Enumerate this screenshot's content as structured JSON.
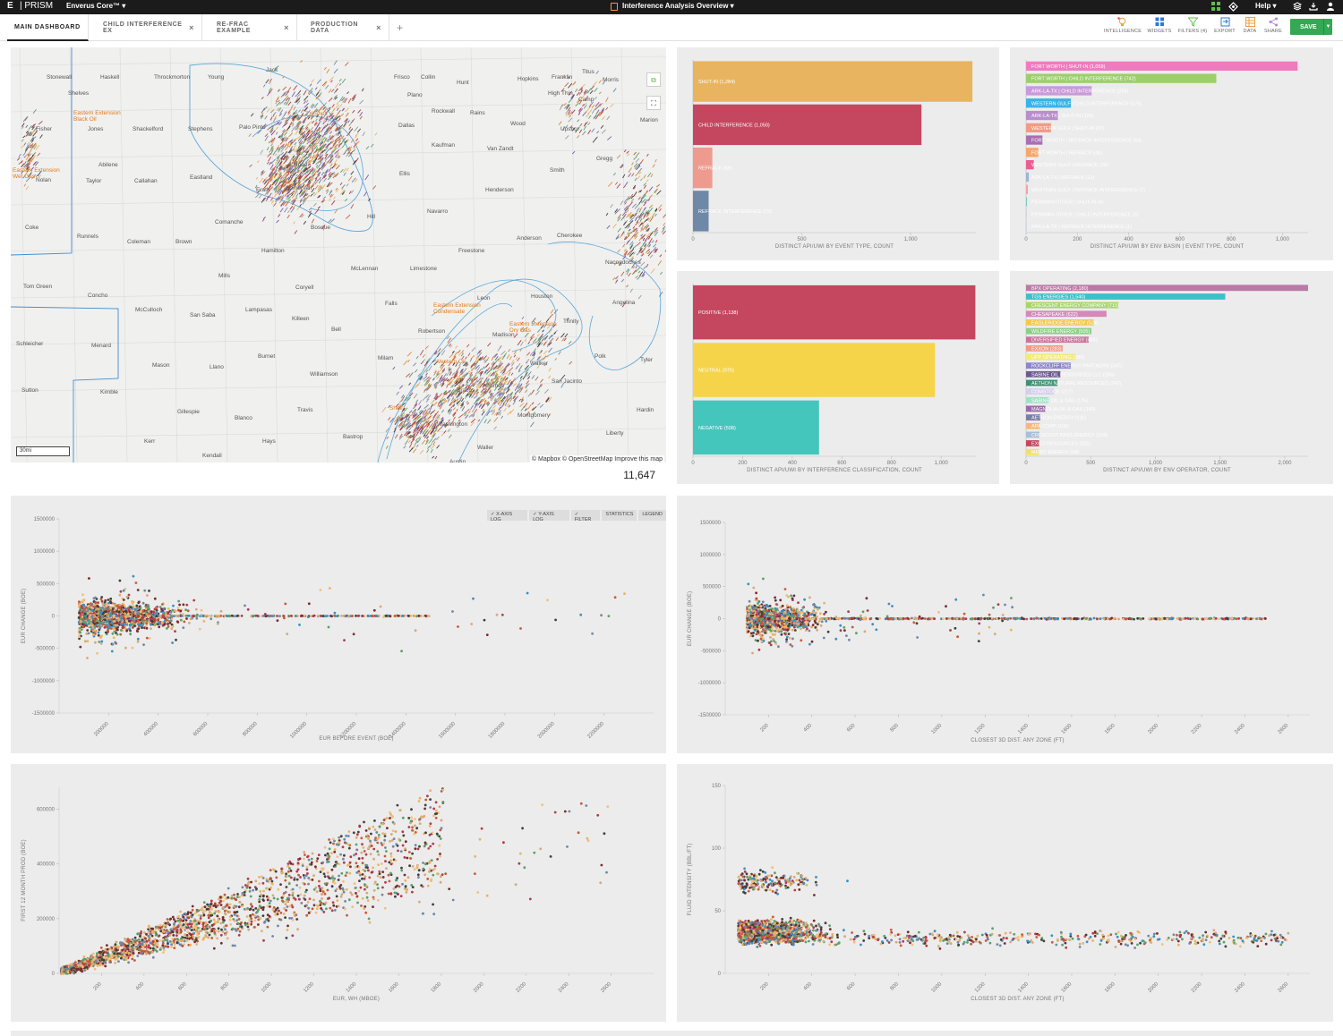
{
  "topbar": {
    "logo": "E",
    "brand": "| PRISM",
    "product": "Enverus Core™ ▾",
    "title": "Interference Analysis Overview ▾",
    "help": "Help ▾"
  },
  "tabs": [
    {
      "label": "MAIN DASHBOARD",
      "active": true
    },
    {
      "label": "CHILD INTERFERENCE EX",
      "active": false
    },
    {
      "label": "RE-FRAC EXAMPLE",
      "active": false
    },
    {
      "label": "PRODUCTION DATA",
      "active": false
    }
  ],
  "tab_add": "+",
  "tab_close": "×",
  "tools": [
    {
      "label": "INTELLIGENCE",
      "icon": "lightbulb-icon"
    },
    {
      "label": "WIDGETS",
      "icon": "grid-icon"
    },
    {
      "label": "FILTERS (4)",
      "icon": "filter-icon"
    },
    {
      "label": "EXPORT",
      "icon": "export-icon"
    },
    {
      "label": "DATA",
      "icon": "table-icon"
    },
    {
      "label": "SHARE",
      "icon": "share-icon"
    }
  ],
  "save_label": "SAVE",
  "map": {
    "count": "11,647",
    "attribution": "© Mapbox © OpenStreetMap  Improve this map",
    "scale": "30mi",
    "labels": [
      {
        "t": "Stonewall"
      },
      {
        "t": "Haskell"
      },
      {
        "t": "Throckmorton"
      },
      {
        "t": "Young"
      },
      {
        "t": "Jack"
      },
      {
        "t": "Shelves"
      },
      {
        "t": "Collin"
      },
      {
        "t": "Hunt"
      },
      {
        "t": "Hopkins"
      },
      {
        "t": "Franklin"
      },
      {
        "t": "Titus"
      },
      {
        "t": "Fisher"
      },
      {
        "t": "Jones"
      },
      {
        "t": "Shackelford"
      },
      {
        "t": "Stephens"
      },
      {
        "t": "Palo Pinto"
      },
      {
        "t": "Dallas"
      },
      {
        "t": "Rockwall"
      },
      {
        "t": "Rains"
      },
      {
        "t": "Wood"
      },
      {
        "t": "Upshur"
      },
      {
        "t": "Abilene"
      },
      {
        "t": "Taylor"
      },
      {
        "t": "Callahan"
      },
      {
        "t": "Eastland"
      },
      {
        "t": "Erath"
      },
      {
        "t": "Kaufman"
      },
      {
        "t": "Van Zandt"
      },
      {
        "t": "Smith"
      },
      {
        "t": "Ellis"
      },
      {
        "t": "Henderson"
      },
      {
        "t": "Nolan"
      },
      {
        "t": "Coke"
      },
      {
        "t": "Runnels"
      },
      {
        "t": "Coleman"
      },
      {
        "t": "Brown"
      },
      {
        "t": "Comanche"
      },
      {
        "t": "Hamilton"
      },
      {
        "t": "Bosque"
      },
      {
        "t": "Hill"
      },
      {
        "t": "Navarro"
      },
      {
        "t": "Anderson"
      },
      {
        "t": "Cherokee"
      },
      {
        "t": "Mills"
      },
      {
        "t": "McLennan"
      },
      {
        "t": "Limestone"
      },
      {
        "t": "Freestone"
      },
      {
        "t": "Nacogdoches"
      },
      {
        "t": "Tom Green"
      },
      {
        "t": "Concho"
      },
      {
        "t": "McCulloch"
      },
      {
        "t": "San Saba"
      },
      {
        "t": "Lampasas"
      },
      {
        "t": "Coryell"
      },
      {
        "t": "Falls"
      },
      {
        "t": "Leon"
      },
      {
        "t": "Houston"
      },
      {
        "t": "Angelina"
      },
      {
        "t": "Trinity"
      },
      {
        "t": "Schleicher"
      },
      {
        "t": "Menard"
      },
      {
        "t": "Mason"
      },
      {
        "t": "Llano"
      },
      {
        "t": "Burnet"
      },
      {
        "t": "Bell"
      },
      {
        "t": "Milam"
      },
      {
        "t": "Robertson"
      },
      {
        "t": "Madison"
      },
      {
        "t": "Walker"
      },
      {
        "t": "Polk"
      },
      {
        "t": "Tyler"
      },
      {
        "t": "Sutton"
      },
      {
        "t": "Kimble"
      },
      {
        "t": "Gillespie"
      },
      {
        "t": "Blanco"
      },
      {
        "t": "Travis"
      },
      {
        "t": "Williamson"
      },
      {
        "t": "Brazos"
      },
      {
        "t": "Grimes"
      },
      {
        "t": "Montgomery"
      },
      {
        "t": "San Jacinto"
      },
      {
        "t": "Hardin"
      },
      {
        "t": "Kerr"
      },
      {
        "t": "Kendall"
      },
      {
        "t": "Hays"
      },
      {
        "t": "Bastrop"
      },
      {
        "t": "Washington"
      },
      {
        "t": "Waller"
      },
      {
        "t": "Liberty"
      },
      {
        "t": "Killeen"
      },
      {
        "t": "Marion"
      },
      {
        "t": "Morris"
      },
      {
        "t": "Camp"
      },
      {
        "t": "Plano"
      },
      {
        "t": "Frisco"
      },
      {
        "t": "High Thin"
      },
      {
        "t": "Gregg"
      },
      {
        "t": "Hood"
      },
      {
        "t": "Somervell"
      },
      {
        "t": "Austin"
      }
    ],
    "orange_labels": [
      {
        "t": "Eastern Extension Black Oil"
      },
      {
        "t": "Eastern Extension Wet Gas"
      },
      {
        "t": "Eastern Extension Condensate"
      },
      {
        "t": "Eastern Extension Dry Gas"
      },
      {
        "t": "Western Oil"
      },
      {
        "t": "Shelf"
      },
      {
        "t": "TX Shelf"
      }
    ]
  },
  "chart_data": [
    {
      "type": "bar",
      "orientation": "horizontal",
      "categories": [
        "SHUT-IN",
        "CHILD INTERFERENCE",
        "REFRACK",
        "REFRACK INTERFERENCE"
      ],
      "values": [
        1284,
        1050,
        89,
        72
      ],
      "colors": [
        "#e8b460",
        "#c4475f",
        "#ef9a8e",
        "#6f88a8"
      ],
      "xlabel": "DISTINCT API/UWI BY EVENT TYPE, COUNT",
      "xticks": [
        "0",
        "500",
        "1,000"
      ],
      "xlim": [
        0,
        1300
      ],
      "labels": [
        "SHUT-IN (1,284)",
        "CHILD INTERFERENCE (1,050)",
        "REFRACK (89)",
        "REFRACK INTERFERENCE (72)"
      ]
    },
    {
      "type": "bar",
      "orientation": "horizontal",
      "categories": [
        "FORT WORTH | SHUT-IN",
        "FORT WORTH | CHILD INTERFERENCE",
        "ARK-LA-TX | CHILD INTERFERENCE",
        "WESTERN GULF | CHILD INTERFERENCE",
        "ARK-LA-TX | SHUT-IN",
        "WESTERN GULF | SHUT-IN",
        "FORT WORTH | REFRACK INTERFERENCE",
        "FORT WORTH | REFRACK",
        "WESTERN GULF | REFRACK",
        "ARK-LA-TX | REFRACK",
        "WESTERN GULF | REFRACK INTERFERENCE",
        "PERMIAN OTHER | SHUT-IN",
        "PERMIAN OTHER | CHILD INTERFERENCE",
        "ARK-LA-TX | REFRACK INTERFERENCE"
      ],
      "values": [
        1059,
        742,
        256,
        175,
        124,
        97,
        64,
        48,
        30,
        11,
        7,
        4,
        2,
        1
      ],
      "colors": [
        "#ef7bbf",
        "#9ccf6a",
        "#c99ad9",
        "#39b3e6",
        "#b98ecc",
        "#f19b86",
        "#a86fb2",
        "#f5a86d",
        "#ea5d92",
        "#9fb4d0",
        "#f4a3a3",
        "#7fcac3",
        "#c7c2e0",
        "#aac3e0"
      ],
      "labels": [
        "FORT WORTH | SHUT-IN (1,059)",
        "FORT WORTH | CHILD INTERFERENCE (742)",
        "ARK-LA-TX | CHILD INTERFERENCE (256)",
        "WESTERN GULF | CHILD INTERFERENCE (175)",
        "ARK-LA-TX | SHUT-IN (124)",
        "WESTERN GULF | SHUT-IN (97)",
        "FORT WORTH | REFRACK INTERFERENCE (64)",
        "FORT WORTH | REFRACK (48)",
        "WESTERN GULF | REFRACK (30)",
        "ARK-LA-TX | REFRACK (11)",
        "WESTERN GULF | REFRACK INTERFERENCE (7)",
        "PERMIAN OTHER | SHUT-IN (4)",
        "PERMIAN OTHER | CHILD INTERFERENCE (2)",
        "ARK-LA-TX | REFRACK INTERFERENCE (1)"
      ],
      "xlabel": "DISTINCT API/UWI BY ENV BASIN | EVENT TYPE, COUNT",
      "xticks": [
        "0",
        "200",
        "400",
        "600",
        "800",
        "1,000"
      ],
      "xlim": [
        0,
        1100
      ]
    },
    {
      "type": "bar",
      "orientation": "horizontal",
      "categories": [
        "POSITIVE",
        "NEUTRAL",
        "NEGATIVE"
      ],
      "values": [
        1138,
        975,
        508
      ],
      "colors": [
        "#c4475f",
        "#f5d44a",
        "#45c6bd"
      ],
      "labels": [
        "POSITIVE (1,138)",
        "NEUTRAL (975)",
        "NEGATIVE (508)"
      ],
      "xlabel": "DISTINCT API/UWI BY INTERFERENCE CLASSIFICATION, COUNT",
      "xticks": [
        "0",
        "200",
        "400",
        "600",
        "800",
        "1,000"
      ],
      "xlim": [
        0,
        1140
      ]
    },
    {
      "type": "bar",
      "orientation": "horizontal",
      "categories": [
        "BPX OPERATING",
        "TGS ENERGIES",
        "CRESCENT ENERGY COMPANY",
        "CHESAPEAKE",
        "EAGLERIDGE ENERGY",
        "WILDFIRE ENERGY",
        "DIVERSIFIED ENERGY",
        "EXXON",
        "UPP OPERATING",
        "ROCKCLIFF ENERGY PARTNERS",
        "SABINE OIL RESOURCES LLC",
        "AETHON NATURAL RESOURCES",
        "COMSTOCK",
        "SABINE OIL & GAS",
        "MAGNOLIA OIL & GAS",
        "AETHON ENERGY",
        "APA CORP",
        "CRESCENT PASS ENERGY",
        "EXCO RESOURCES",
        "MERIT ENERGY"
      ],
      "values": [
        2180,
        1540,
        715,
        622,
        524,
        505,
        484,
        283,
        385,
        347,
        266,
        242,
        217,
        175,
        149,
        111,
        106,
        104,
        101,
        98
      ],
      "colors": [
        "#b97aa8",
        "#39c2c8",
        "#a9d46c",
        "#d589b7",
        "#f3c84d",
        "#8ccf86",
        "#c8759d",
        "#f19b86",
        "#f4e97a",
        "#8d86c8",
        "#6b5b8f",
        "#3f8f74",
        "#d3d0ec",
        "#a0e0c4",
        "#9b6aa8",
        "#7c7ea8",
        "#f5b878",
        "#a9bfd8",
        "#c04a5c",
        "#f1e16a"
      ],
      "labels": [
        "BPX OPERATING (2,180)",
        "TGS ENERGIES (1,540)",
        "CRESCENT ENERGY COMPANY (715)",
        "CHESAPEAKE (622)",
        "EAGLERIDGE ENERGY (524)",
        "WILDFIRE ENERGY (505)",
        "DIVERSIFIED ENERGY (484)",
        "EXXON (283)",
        "UPP OPERATING (385)",
        "ROCKCLIFF ENERGY PARTNERS (347)",
        "SABINE OIL RESOURCES LLC (266)",
        "AETHON NATURAL RESOURCES (242)",
        "COMSTOCK (217)",
        "SABINE OIL & GAS (175)",
        "MAGNOLIA OIL & GAS (149)",
        "AETHON ENERGY (111)",
        "APA CORP (106)",
        "CRESCENT PASS ENERGY (104)",
        "EXCO RESOURCES (101)",
        "MERIT ENERGY (98)"
      ],
      "xlabel": "DISTINCT API/UWI BY ENV OPERATOR, COUNT",
      "xticks": [
        "0",
        "500",
        "1,000",
        "1,500",
        "2,000"
      ],
      "xlim": [
        0,
        2180
      ]
    },
    {
      "type": "scatter",
      "xlabel": "EUR BEFORE EVENT (BOE)",
      "ylabel": "EUR CHANGE (BOE)",
      "xlim": [
        0,
        2400000
      ],
      "ylim": [
        -1500000,
        1500000
      ],
      "xticks": [
        "200000",
        "400000",
        "600000",
        "800000",
        "1000000",
        "1200000",
        "1400000",
        "1600000",
        "1800000",
        "2000000",
        "2200000"
      ],
      "yticks": [
        "1500000",
        "1000000",
        "500000",
        "0",
        "-500000",
        "-1000000",
        "-1500000"
      ],
      "toolbar": [
        "X-AXIS LOG",
        "Y-AXIS LOG",
        "FILTER",
        "STATISTICS",
        "LEGEND"
      ]
    },
    {
      "type": "scatter",
      "xlabel": "CLOSEST 3D DIST. ANY ZONE (FT)",
      "ylabel": "EUR CHANGE (BOE)",
      "xlim": [
        0,
        2700
      ],
      "ylim": [
        -1500000,
        1500000
      ],
      "xticks": [
        "200",
        "400",
        "600",
        "800",
        "1000",
        "1200",
        "1400",
        "1600",
        "1800",
        "2000",
        "2200",
        "2400",
        "2600"
      ],
      "yticks": [
        "1500000",
        "1000000",
        "500000",
        "0",
        "-500000",
        "-1000000",
        "-1500000"
      ]
    },
    {
      "type": "scatter",
      "xlabel": "EUR, WH (MBOE)",
      "ylabel": "FIRST 12 MONTH PROD (BOE)",
      "xlim": [
        0,
        2800
      ],
      "ylim": [
        0,
        680000
      ],
      "xticks": [
        "200",
        "400",
        "600",
        "800",
        "1000",
        "1200",
        "1400",
        "1600",
        "1800",
        "2000",
        "2200",
        "2400",
        "2600"
      ],
      "yticks": [
        "600000",
        "400000",
        "200000",
        "0"
      ]
    },
    {
      "type": "scatter",
      "xlabel": "CLOSEST 3D DIST. ANY ZONE (FT)",
      "ylabel": "FLUID INTENSITY (BBL/FT)",
      "xlim": [
        0,
        2700
      ],
      "ylim": [
        0,
        150
      ],
      "xticks": [
        "200",
        "400",
        "600",
        "800",
        "1000",
        "1200",
        "1400",
        "1600",
        "1800",
        "2000",
        "2200",
        "2400",
        "2600"
      ],
      "yticks": [
        "150",
        "100",
        "50",
        "0"
      ]
    }
  ]
}
